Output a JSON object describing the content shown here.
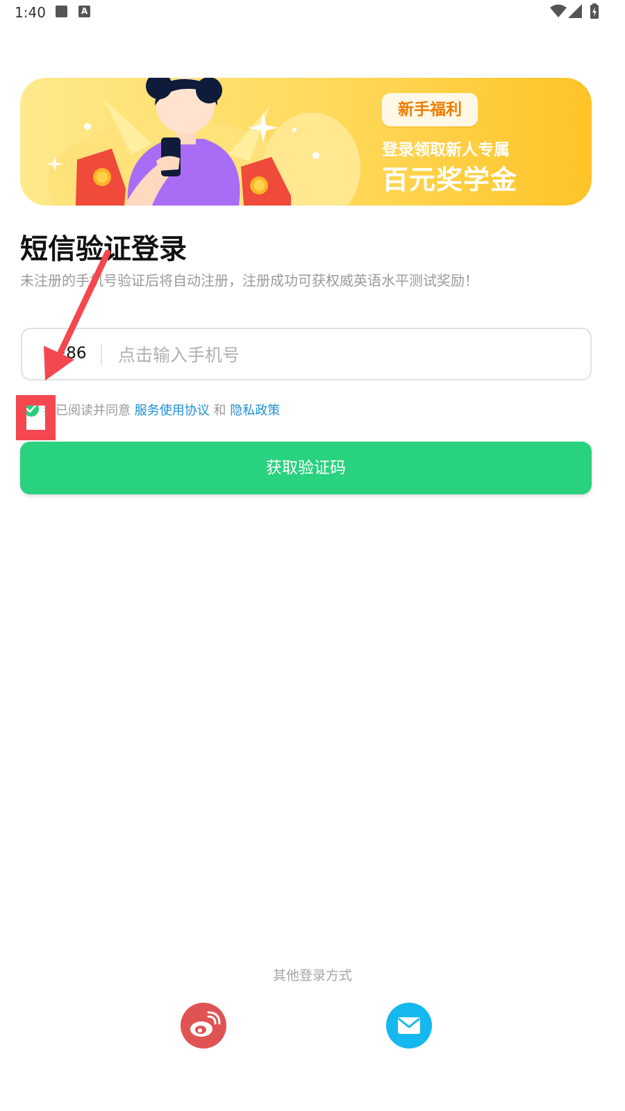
{
  "status_bar": {
    "time": "1:40",
    "a_badge": "A"
  },
  "banner": {
    "badge": "新手福利",
    "subtitle": "登录领取新人专属",
    "headline": "百元奖学金"
  },
  "login": {
    "title": "短信验证登录",
    "description": "未注册的手机号验证后将自动注册，注册成功可获权威英语水平测试奖励！",
    "country_code": "+86",
    "phone_placeholder": "点击输入手机号",
    "phone_value": ""
  },
  "agreement": {
    "checked": true,
    "prefix": "我已阅读并同意",
    "terms_link": "服务使用协议",
    "and": "和",
    "privacy_link": "隐私政策"
  },
  "get_code_button": "获取验证码",
  "other_login": {
    "label": "其他登录方式",
    "methods": [
      "weibo-icon",
      "mail-icon"
    ]
  },
  "colors": {
    "accent_green": "#29d27f",
    "link_blue": "#1e8ed6",
    "annotation_red": "#f4474f",
    "banner_yellow": "#ffd95a"
  }
}
